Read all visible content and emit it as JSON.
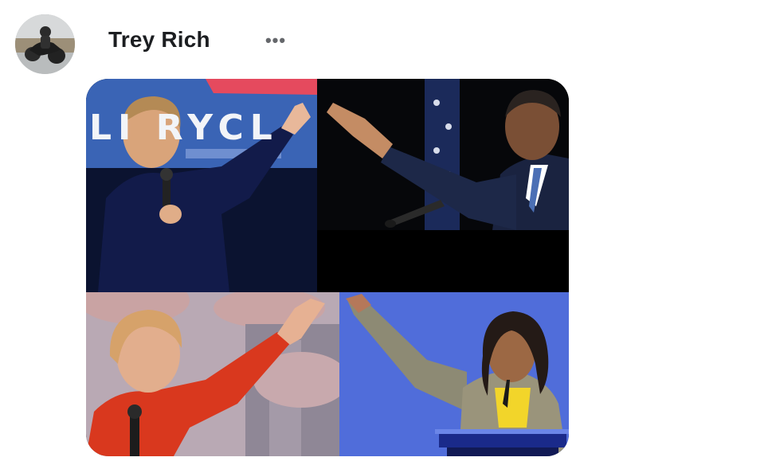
{
  "post": {
    "author": {
      "name": "Trey Rich",
      "avatar_icon": "person-with-motorcycle-avatar"
    },
    "menu": {
      "more_label": "•••",
      "icon": "more-horizontal-icon"
    },
    "media": {
      "panel_1": {
        "sign_text": "LI RYCL"
      }
    }
  },
  "colors": {
    "name_text": "#1c1e21",
    "menu_dots": "#65676b",
    "background": "#ffffff"
  }
}
